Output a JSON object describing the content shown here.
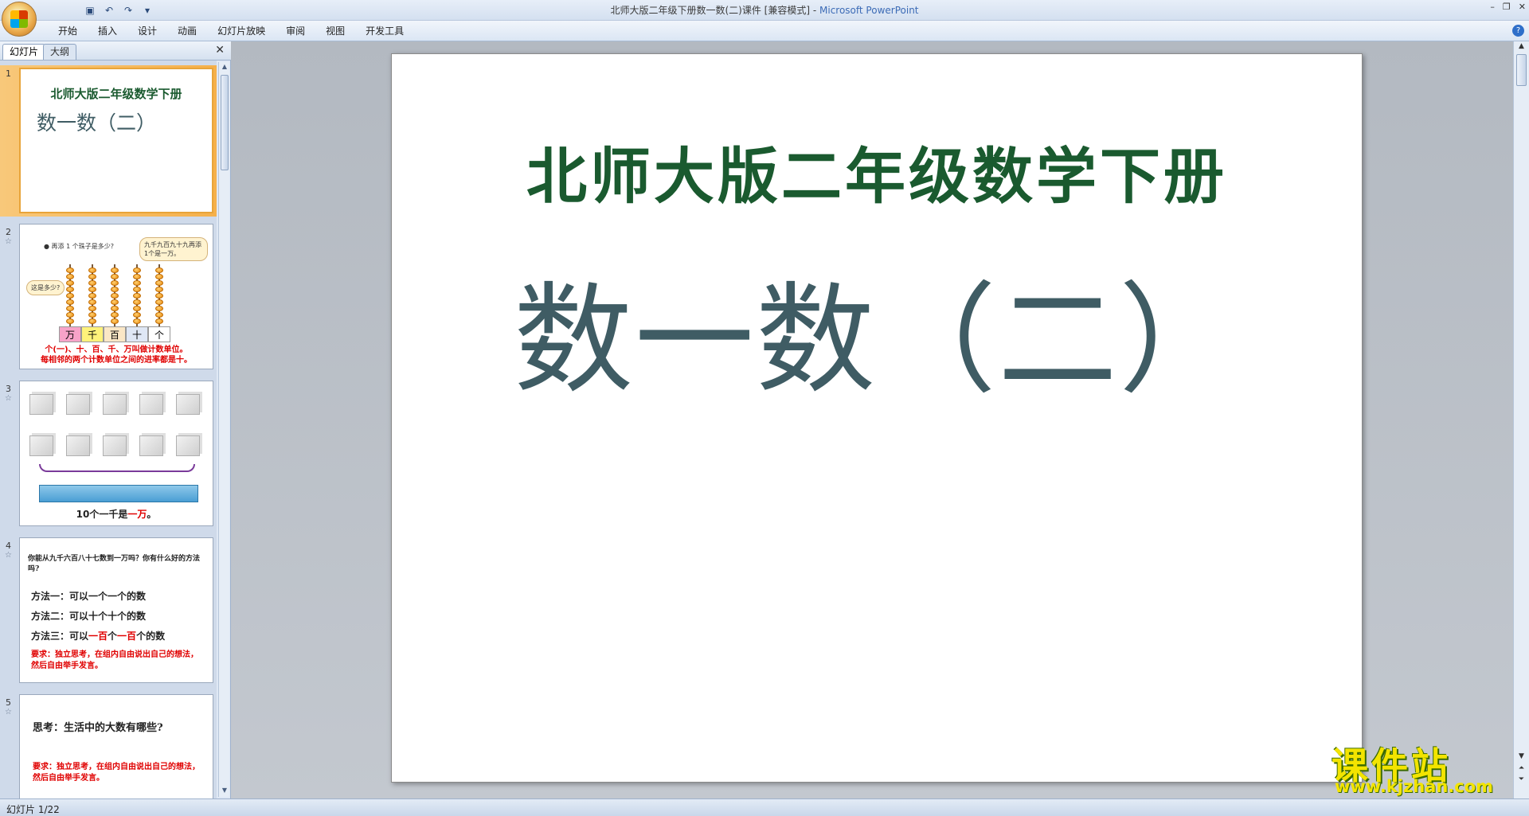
{
  "window": {
    "title": "北师大版二年级下册数一数(二)课件 [兼容模式] - ",
    "app_name": "Microsoft PowerPoint",
    "controls": [
      "–",
      "❐",
      "✕"
    ]
  },
  "ribbon": {
    "tabs": [
      "开始",
      "插入",
      "设计",
      "动画",
      "幻灯片放映",
      "审阅",
      "视图",
      "开发工具"
    ],
    "help": "?"
  },
  "panel": {
    "tabs": [
      "幻灯片",
      "大纲"
    ],
    "close": "✕"
  },
  "thumbnails": [
    {
      "num": "1",
      "title": "北师大版二年级数学下册",
      "subtitle": "数一数（二）"
    },
    {
      "num": "2",
      "question": "● 再添 1 个珠子是多少?",
      "bubble_right": "九千九百九十九再添1个是一万。",
      "bubble_left": "这是多少?",
      "places": [
        "万",
        "千",
        "百",
        "十",
        "个"
      ],
      "rule1": "个(一)、十、百、千、万叫做计数单位。",
      "rule2": "每相邻的两个计数单位之间的进率都是十。"
    },
    {
      "num": "3",
      "label_pre": "10个一千是",
      "label_red": "一万",
      "label_post": "。"
    },
    {
      "num": "4",
      "question": "你能从九千六百八十七数到一万吗？你有什么好的方法吗?",
      "m1": "方法一：可以一个一个的数",
      "m2": "方法二：可以十个十个的数",
      "m3_a": "方法三：可以",
      "m3_b": "一百",
      "m3_c": "个",
      "m3_d": "一百",
      "m3_e": "个的数",
      "req": "要求：独立思考，在组内自由说出自己的想法，然后自由举手发言。"
    },
    {
      "num": "5",
      "question": "思考：生活中的大数有哪些?",
      "req": "要求：独立思考，在组内自由说出自己的想法，然后自由举手发言。"
    }
  ],
  "slide": {
    "title": "北师大版二年级数学下册",
    "subtitle": "数一数（二）"
  },
  "watermark": {
    "text": "课件站",
    "url": "www.kjzhan.com"
  },
  "status": {
    "slide_info": "幻灯片 1/22"
  },
  "colors": {
    "title_green": "#1a5a2f",
    "subtitle_slate": "#3f5c64",
    "accent_red": "#e00000",
    "selection_orange": "#f5b04a"
  }
}
